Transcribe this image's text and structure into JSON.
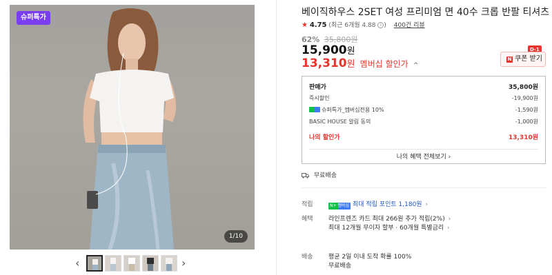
{
  "gallery": {
    "badge": "슈퍼특가",
    "counter": "1/10",
    "prev_arrow": "‹",
    "next_arrow": "›",
    "thumbnail_count": 5
  },
  "product": {
    "title": "베이직하우스 2SET 여성 프리미엄 면 40수 크롭 반팔 티셔츠",
    "rating": {
      "star": "★",
      "score": "4.75",
      "recent": "(최근 6개월 4.88",
      "info": "i",
      "recent_close": ")",
      "reviews": "400건 리뷰"
    },
    "discount_pct": "62%",
    "original_price": "35,800원",
    "price": "15,900",
    "won": "원",
    "member_price": "13,310",
    "member_label": "멤버십 할인가",
    "member_caret": "^"
  },
  "coupon": {
    "dday": "D-1",
    "icon": "N",
    "label": "쿠폰 받기"
  },
  "breakdown": {
    "sale_label": "판매가",
    "sale_value": "35,800원",
    "rows": [
      {
        "label": "즉시할인",
        "value": "-19,900원"
      },
      {
        "label": "슈퍼특가_멤버십전용 10%",
        "value": "-1,590원"
      },
      {
        "label": "BASIC HOUSE 알림 동의",
        "value": "-1,000원"
      }
    ],
    "mine_label": "나의 할인가",
    "mine_value": "13,310원",
    "more": "나의 혜택 전체보기",
    "more_chev": "›"
  },
  "delivery": {
    "label": "무료배송"
  },
  "points": {
    "label": "적립",
    "badge": "N+ 멤버십",
    "text": "최대 적립 포인트 1,180원",
    "chev": "›"
  },
  "benefits": {
    "label": "혜택",
    "lines": [
      "라인프렌즈 카드 최대 266원 추가 적립(2%)",
      "최대 12개월 무이자 할부 · 60개월 특별금리"
    ],
    "chev": "›"
  },
  "shipping": {
    "label": "배송",
    "lines": [
      "평균 2일 이내 도착 확률 100%",
      "무료배송"
    ]
  },
  "colors": {
    "red": "#e5352c",
    "purple": "#7a3df0",
    "blue": "#2255c6",
    "green": "#12c14a"
  }
}
